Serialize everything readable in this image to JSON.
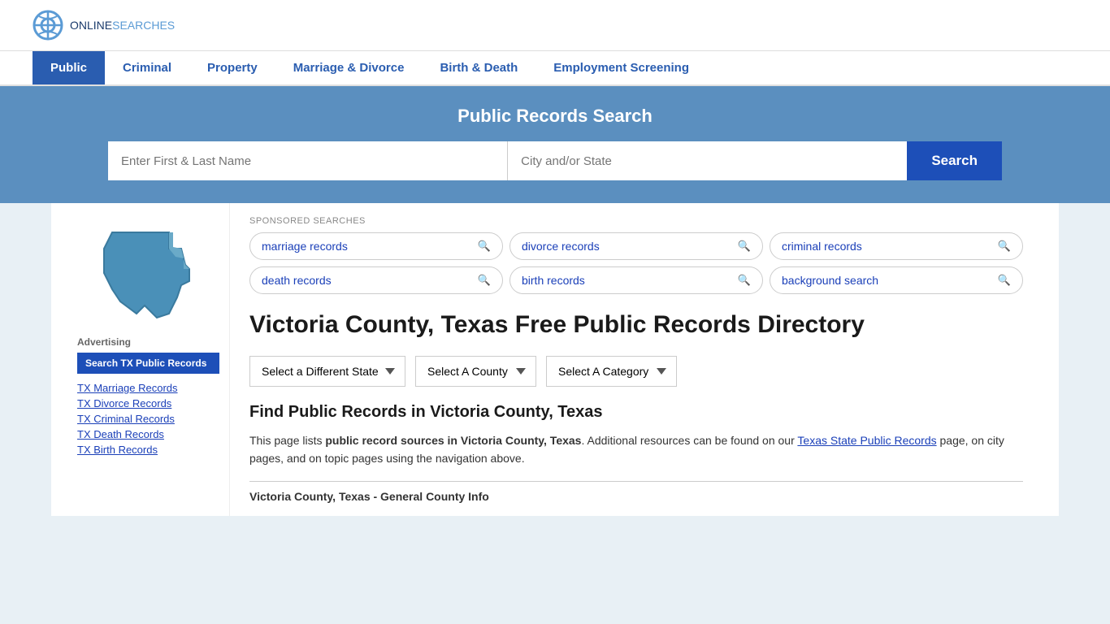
{
  "header": {
    "logo_online": "ONLINE",
    "logo_searches": "SEARCHES"
  },
  "nav": {
    "items": [
      {
        "label": "Public",
        "active": true
      },
      {
        "label": "Criminal",
        "active": false
      },
      {
        "label": "Property",
        "active": false
      },
      {
        "label": "Marriage & Divorce",
        "active": false
      },
      {
        "label": "Birth & Death",
        "active": false
      },
      {
        "label": "Employment Screening",
        "active": false
      }
    ]
  },
  "hero": {
    "title": "Public Records Search",
    "name_placeholder": "Enter First & Last Name",
    "location_placeholder": "City and/or State",
    "search_button": "Search"
  },
  "sponsored": {
    "label": "SPONSORED SEARCHES",
    "items": [
      "marriage records",
      "divorce records",
      "criminal records",
      "death records",
      "birth records",
      "background search"
    ]
  },
  "directory": {
    "title": "Victoria County, Texas Free Public Records Directory",
    "dropdown_state": "Select a Different State",
    "dropdown_county": "Select A County",
    "dropdown_category": "Select A Category",
    "find_title": "Find Public Records in Victoria County, Texas",
    "find_desc_part1": "This page lists ",
    "find_desc_bold": "public record sources in Victoria County, Texas",
    "find_desc_part2": ". Additional resources can be found on our ",
    "find_link_text": "Texas State Public Records",
    "find_desc_part3": " page, on city pages, and on topic pages using the navigation above.",
    "county_info_label": "Victoria County, Texas - General County Info"
  },
  "sidebar": {
    "advertising_label": "Advertising",
    "ad_button_label": "Search TX Public Records",
    "links": [
      "TX Marriage Records",
      "TX Divorce Records",
      "TX Criminal Records",
      "TX Death Records",
      "TX Birth Records"
    ]
  }
}
